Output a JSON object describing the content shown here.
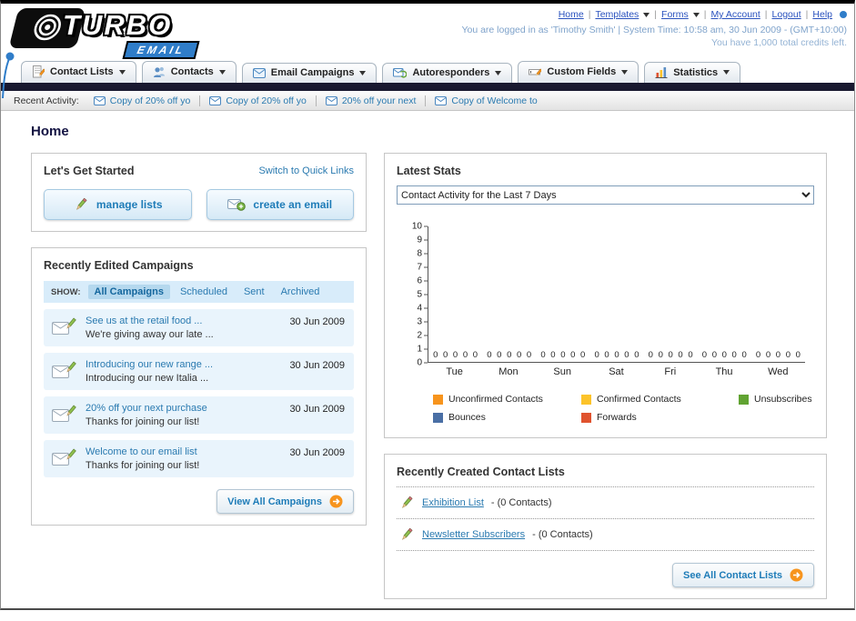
{
  "page_title": "Home",
  "colors": {
    "accent_teal": "#2a7ab0",
    "accent_orange": "#f7941d",
    "nav_bar_dark": "#191930",
    "brand_blue": "#2f7dc9"
  },
  "header": {
    "logo_text": "TURBO",
    "logo_sub": "EMAIL",
    "links": [
      {
        "label": "Home",
        "dropdown": false
      },
      {
        "label": "Templates",
        "dropdown": true
      },
      {
        "label": "Forms",
        "dropdown": true
      },
      {
        "label": "My Account",
        "dropdown": false
      },
      {
        "label": "Logout",
        "dropdown": false
      },
      {
        "label": "Help",
        "dropdown": false
      }
    ],
    "session_line": "You are logged in as 'Timothy Smith' | System Time: 10:58 am, 30 Jun 2009 - (GMT+10:00)",
    "credits_line": "You have 1,000 total credits left."
  },
  "nav": {
    "tabs": [
      {
        "label": "Contact Lists",
        "icon": "contact-lists-icon"
      },
      {
        "label": "Contacts",
        "icon": "contacts-icon"
      },
      {
        "label": "Email Campaigns",
        "icon": "email-campaigns-icon"
      },
      {
        "label": "Autoresponders",
        "icon": "autoresponders-icon"
      },
      {
        "label": "Custom Fields",
        "icon": "custom-fields-icon"
      },
      {
        "label": "Statistics",
        "icon": "statistics-icon"
      }
    ]
  },
  "recent_activity": {
    "label": "Recent Activity:",
    "items": [
      {
        "text": "Copy of 20% off yo",
        "icon": "email-icon"
      },
      {
        "text": "Copy of 20% off yo",
        "icon": "email-icon"
      },
      {
        "text": "20% off your next",
        "icon": "email-icon"
      },
      {
        "text": "Copy of Welcome to",
        "icon": "email-icon"
      }
    ]
  },
  "get_started": {
    "title": "Let's Get Started",
    "switch_link": "Switch to Quick Links",
    "manage_lists_label": "manage lists",
    "create_email_label": "create an email"
  },
  "campaigns": {
    "title": "Recently Edited Campaigns",
    "show_label": "SHOW:",
    "filters": [
      "All Campaigns",
      "Scheduled",
      "Sent",
      "Archived"
    ],
    "active_filter": 0,
    "items": [
      {
        "title": "See us at the retail food ...",
        "subtitle": "We're giving away our late ...",
        "date": "30 Jun 2009"
      },
      {
        "title": "Introducing our new range ...",
        "subtitle": "Introducing our new Italia ...",
        "date": "30 Jun 2009"
      },
      {
        "title": "20% off your next purchase",
        "subtitle": "Thanks for joining our list!",
        "date": "30 Jun 2009"
      },
      {
        "title": "Welcome to our email list",
        "subtitle": "Thanks for joining our list!",
        "date": "30 Jun 2009"
      }
    ],
    "view_all_label": "View All Campaigns"
  },
  "stats": {
    "title": "Latest Stats",
    "dropdown_value": "Contact Activity for the Last 7 Days",
    "chart_data": {
      "type": "bar",
      "title": "Contact Activity for the Last 7 Days",
      "categories": [
        "Tue",
        "Mon",
        "Sun",
        "Sat",
        "Fri",
        "Thu",
        "Wed"
      ],
      "series": [
        {
          "name": "Unconfirmed Contacts",
          "color": "#f7941d",
          "values": [
            0,
            0,
            0,
            0,
            0,
            0,
            0
          ]
        },
        {
          "name": "Confirmed Contacts",
          "color": "#fcc32a",
          "values": [
            0,
            0,
            0,
            0,
            0,
            0,
            0
          ]
        },
        {
          "name": "Unsubscribes",
          "color": "#61a332",
          "values": [
            0,
            0,
            0,
            0,
            0,
            0,
            0
          ]
        },
        {
          "name": "Bounces",
          "color": "#4a6fa5",
          "values": [
            0,
            0,
            0,
            0,
            0,
            0,
            0
          ]
        },
        {
          "name": "Forwards",
          "color": "#e0532f",
          "values": [
            0,
            0,
            0,
            0,
            0,
            0,
            0
          ]
        }
      ],
      "ylim": [
        0,
        10
      ],
      "ytick_step": 1,
      "grid": false,
      "legend_position": "bottom"
    }
  },
  "contact_lists": {
    "title": "Recently Created Contact Lists",
    "items": [
      {
        "name": "Exhibition List",
        "count_text": "- (0 Contacts)"
      },
      {
        "name": "Newsletter Subscribers",
        "count_text": "- (0 Contacts)"
      }
    ],
    "see_all_label": "See All Contact Lists"
  }
}
